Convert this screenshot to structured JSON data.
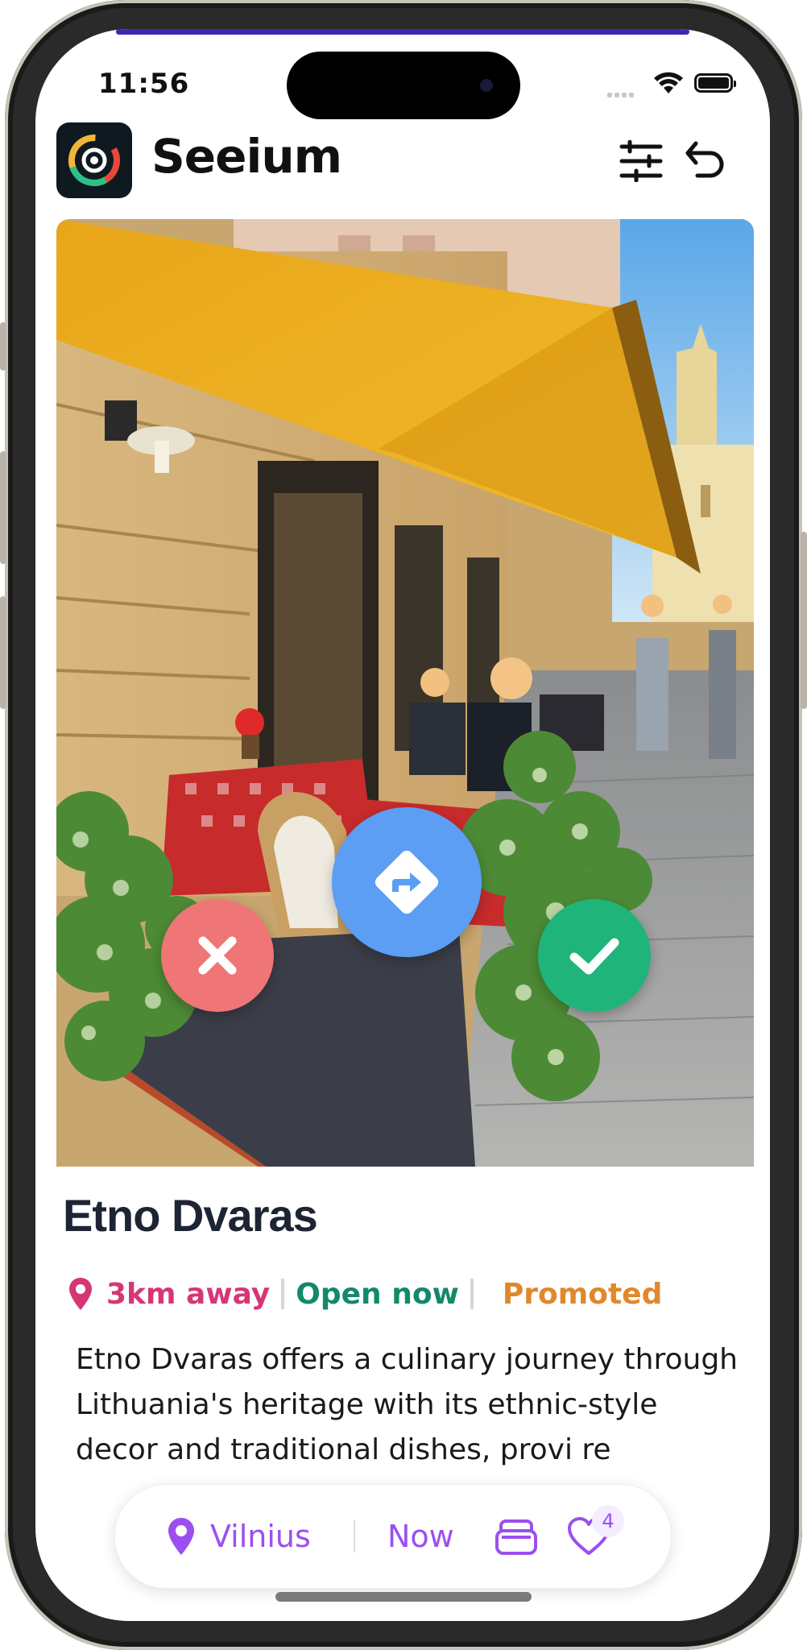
{
  "status_bar": {
    "time": "11:56"
  },
  "app": {
    "title": "Seeium"
  },
  "header": {
    "filter_icon": "sliders-icon",
    "undo_icon": "undo-icon"
  },
  "photo": {
    "description_icon": "restaurant-terrace-photo"
  },
  "actions": {
    "reject_icon": "close-icon",
    "share_icon": "directions-icon",
    "accept_icon": "check-icon"
  },
  "place": {
    "name": "Etno Dvaras",
    "distance": "3km away",
    "open_status": "Open now",
    "promoted": "Promoted",
    "description": "Etno Dvaras offers a culinary journey through Lithuania's heritage with its ethnic-style decor and traditional dishes, provi re"
  },
  "bottom_bar": {
    "location": "Vilnius",
    "time_filter": "Now",
    "favorites_count": "4"
  },
  "colors": {
    "accent": "#9b4ff0",
    "distance": "#d63774",
    "open": "#13896a",
    "promoted": "#e0882c",
    "reject": "#f07576",
    "share": "#5b9ef3",
    "accept": "#1fb47a"
  }
}
